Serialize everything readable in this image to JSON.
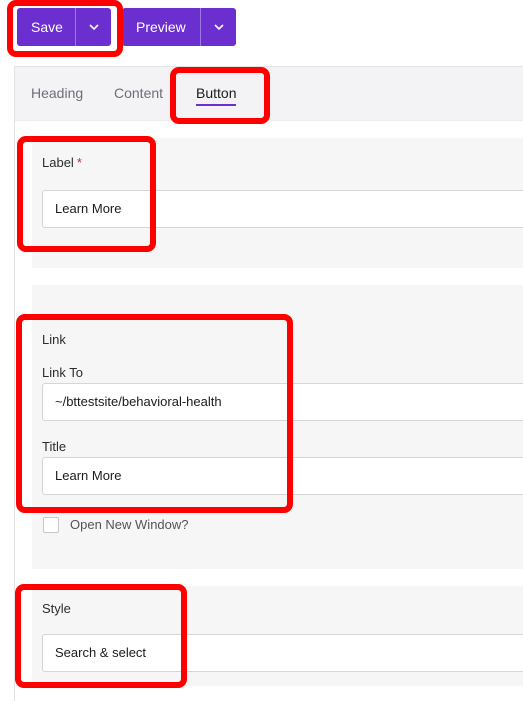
{
  "toolbar": {
    "save_label": "Save",
    "preview_label": "Preview",
    "accent": "#6b2fd0"
  },
  "tabs": [
    {
      "label": "Heading"
    },
    {
      "label": "Content"
    },
    {
      "label": "Button",
      "active": true
    }
  ],
  "label_section": {
    "label": "Label",
    "required_mark": "*",
    "value": "Learn More"
  },
  "link_section": {
    "heading": "Link",
    "link_to_label": "Link To",
    "link_to_value": "~/bttestsite/behavioral-health",
    "title_label": "Title",
    "title_value": "Learn More",
    "new_window_label": "Open New Window?",
    "new_window_checked": false
  },
  "style_section": {
    "label": "Style",
    "placeholder": "Search & select"
  },
  "colors": {
    "highlight": "#ff0000",
    "required": "#d42054"
  }
}
